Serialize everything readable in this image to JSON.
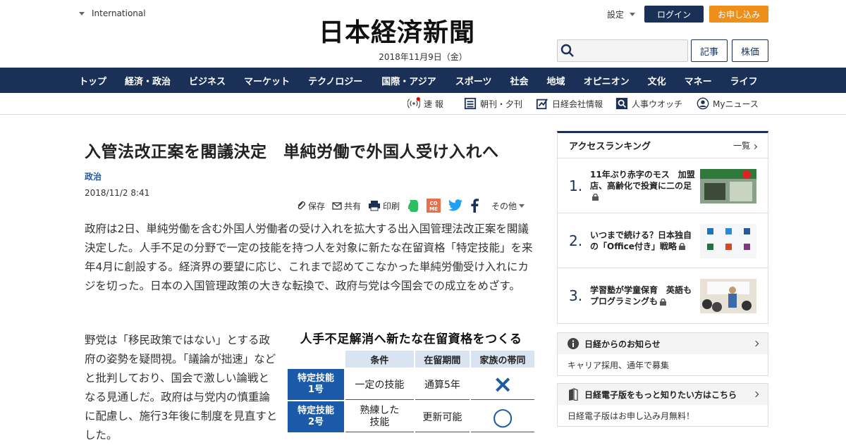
{
  "header": {
    "region": "International",
    "logo": "日本経済新聞",
    "date": "2018年11月9日（金）",
    "settings": "設定",
    "login": "ログイン",
    "subscribe": "お申し込み",
    "search_placeholder": "",
    "btn_articles": "記事",
    "btn_stocks": "株価"
  },
  "nav": [
    "トップ",
    "経済・政治",
    "ビジネス",
    "マーケット",
    "テクノロジー",
    "国際・アジア",
    "スポーツ",
    "社会",
    "地域",
    "オピニオン",
    "文化",
    "マネー",
    "ライフ"
  ],
  "subnav": {
    "breaking": "速 報",
    "edition": "朝刊・夕刊",
    "company": "日経会社情報",
    "personnel": "人事ウオッチ",
    "mynews": "Myニュース"
  },
  "article": {
    "title": "入管法改正案を閣議決定　単純労働で外国人受け入れへ",
    "category": "政治",
    "timestamp": "2018/11/2 8:41",
    "share": {
      "save": "保存",
      "share": "共有",
      "print": "印刷",
      "others": "その他"
    },
    "lead": "政府は2日、単純労働を含む外国人労働者の受け入れを拡大する出入国管理法改正案を閣議決定した。人手不足の分野で一定の技能を持つ人を対象に新たな在留資格「特定技能」を来年4月に創設する。経済界の要望に応じ、これまで認めてこなかった単純労働受け入れにカジを切った。日本の入国管理政策の大きな転換で、政府与党は今国会での成立をめざす。",
    "para2": "野党は「移民政策ではない」とする政府の姿勢を疑問視。「議論が拙速」などと批判しており、国会で激しい論戦となる見通しだ。政府は与党内の慎重論に配慮し、施行3年後に制度を見直すとした。",
    "figure": {
      "title": "人手不足解消へ新たな在留資格をつくる",
      "headers": [
        "条件",
        "在留期間",
        "家族の帯同"
      ],
      "rows": [
        {
          "label": "特定技能\n1号",
          "condition": "一定の技能",
          "period": "通算5年",
          "family": "×"
        },
        {
          "label": "特定技能\n2号",
          "condition": "熟練した\n技能",
          "period": "更新可能",
          "family": "○"
        }
      ]
    }
  },
  "ranking": {
    "title": "アクセスランキング",
    "more": "一覧",
    "items": [
      {
        "rank": "1.",
        "title": "11年ぶり赤字のモス　加盟店、高齢化で投資に二の足"
      },
      {
        "rank": "2.",
        "title": "いつまで続ける？日本独自の「Office付き」戦略"
      },
      {
        "rank": "3.",
        "title": "学習塾が学童保育　英語もプログラミングも"
      }
    ]
  },
  "notice": {
    "title": "日経からのお知らせ",
    "body": "キャリア採用、通年で募集"
  },
  "digital": {
    "title": "日経電子版をもっと知りたい方はこちら",
    "body": "日経電子版はお申し込み月無料！"
  },
  "colors": {
    "navy": "#1a3057",
    "orange": "#ee8f1c",
    "blue": "#1a5aa8"
  }
}
